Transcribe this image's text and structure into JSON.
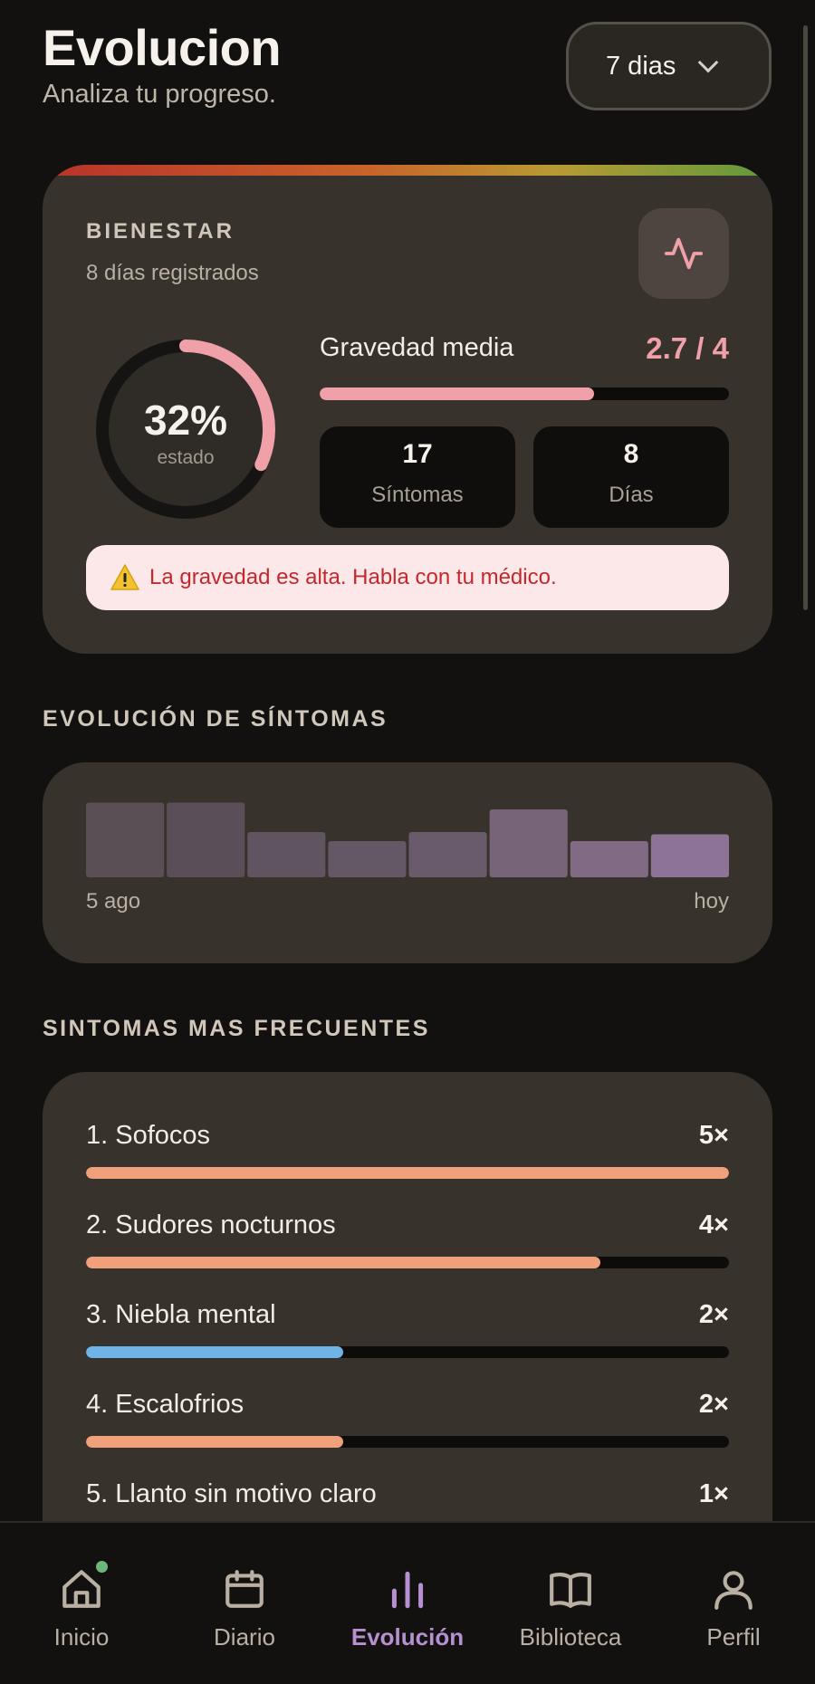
{
  "header": {
    "title": "Evolucion",
    "subtitle": "Analiza tu progreso.",
    "range_select": "7 dias"
  },
  "wellbeing": {
    "label": "BIENESTAR",
    "days_registered": "8 días registrados",
    "state_percent": 32,
    "state_percent_text": "32%",
    "state_label": "estado",
    "severity_label": "Gravedad media",
    "severity_value": "2.7 / 4",
    "severity_fraction": 0.67,
    "stats": [
      {
        "value": "17",
        "label": "Síntomas"
      },
      {
        "value": "8",
        "label": "Días"
      }
    ],
    "alert_text": "La gravedad es alta. Habla con tu médico."
  },
  "evolution": {
    "section_title": "EVOLUCIÓN DE SÍNTOMAS",
    "start_label": "5 ago",
    "end_label": "hoy"
  },
  "frequent": {
    "section_title": "SINTOMAS MAS FRECUENTES",
    "items": [
      {
        "name": "1. Sofocos",
        "count": "5×",
        "fraction": 1.0,
        "color": "#f0a07a"
      },
      {
        "name": "2. Sudores nocturnos",
        "count": "4×",
        "fraction": 0.8,
        "color": "#f0a07a"
      },
      {
        "name": "3. Niebla mental",
        "count": "2×",
        "fraction": 0.4,
        "color": "#6eb4e6"
      },
      {
        "name": "4. Escalofrios",
        "count": "2×",
        "fraction": 0.4,
        "color": "#f0a07a"
      },
      {
        "name": "5. Llanto sin motivo claro",
        "count": "1×",
        "fraction": 0.2,
        "color": "#f0a07a"
      }
    ]
  },
  "nav": {
    "items": [
      {
        "label": "Inicio",
        "icon": "home-icon"
      },
      {
        "label": "Diario",
        "icon": "calendar-icon"
      },
      {
        "label": "Evolución",
        "icon": "bar-chart-icon",
        "active": true
      },
      {
        "label": "Biblioteca",
        "icon": "book-icon"
      },
      {
        "label": "Perfil",
        "icon": "user-icon"
      }
    ]
  },
  "colors": {
    "accent_pink": "#f0a0a8",
    "accent_purple": "#b690d0",
    "alert_red": "#c3282c",
    "card_bg": "#37322b"
  },
  "chart_data": {
    "type": "bar",
    "categories": [
      "5 ago",
      "",
      "",
      "",
      "",
      "",
      "",
      "hoy"
    ],
    "values": [
      3.3,
      3.3,
      2.0,
      1.6,
      2.0,
      3.0,
      1.6,
      1.9
    ],
    "ylim": [
      0,
      4
    ],
    "grid": false,
    "xlabel": "",
    "ylabel": "",
    "colors": [
      "#5a4f54",
      "#5a4f58",
      "#5f5460",
      "#645766",
      "#695a6c",
      "#786478",
      "#806a84",
      "#8d7396"
    ]
  }
}
